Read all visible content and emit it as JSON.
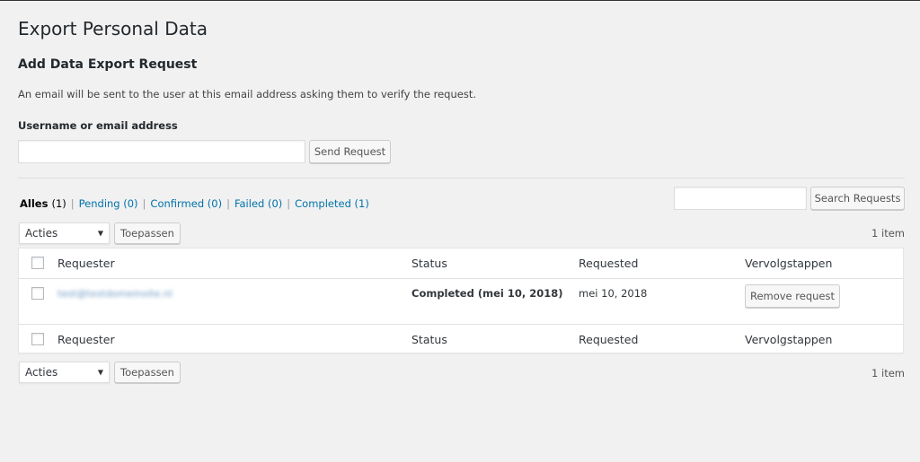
{
  "page_title": "Export Personal Data",
  "form": {
    "heading": "Add Data Export Request",
    "description": "An email will be sent to the user at this email address asking them to verify the request.",
    "field_label": "Username or email address",
    "input_value": "",
    "send_button": "Send Request"
  },
  "views": {
    "all": {
      "label": "Alles",
      "count": "(1)"
    },
    "pending": "Pending (0)",
    "confirmed": "Confirmed (0)",
    "failed": "Failed (0)",
    "completed": "Completed (1)",
    "separator": "|"
  },
  "search": {
    "input_value": "",
    "button": "Search Requests"
  },
  "bulk_top": {
    "selected": "Acties",
    "apply": "Toepassen",
    "items_count": "1 item"
  },
  "bulk_bottom": {
    "selected": "Acties",
    "apply": "Toepassen",
    "items_count": "1 item"
  },
  "table": {
    "columns": [
      "Requester",
      "Status",
      "Requested",
      "Vervolgstappen"
    ],
    "rows": [
      {
        "requester": "test@testdomeinsite.nl",
        "status": "Completed (mei 10, 2018)",
        "requested": "mei 10, 2018",
        "action": "Remove request"
      }
    ]
  }
}
